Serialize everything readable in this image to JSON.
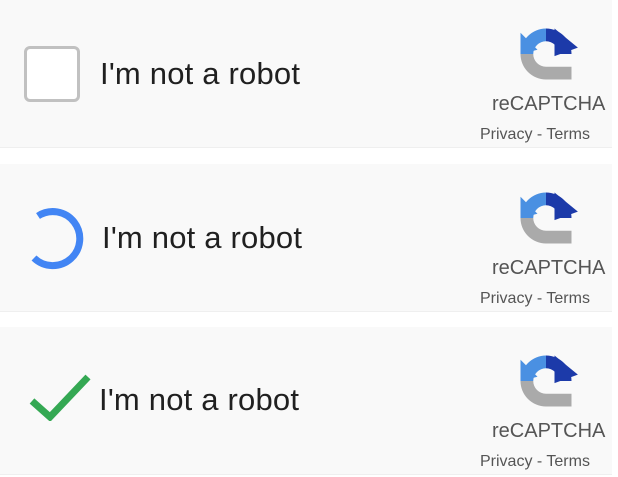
{
  "colors": {
    "spinner": "#4285f4",
    "check": "#34a853",
    "logo_blue_dark": "#1c3aa9",
    "logo_blue": "#4a90e2",
    "logo_gray": "#aaaaaa"
  },
  "widgets": [
    {
      "state": "unchecked",
      "label": "I'm not a robot",
      "brand": "reCAPTCHA",
      "privacy": "Privacy",
      "separator": " - ",
      "terms": "Terms"
    },
    {
      "state": "loading",
      "label": "I'm not a robot",
      "brand": "reCAPTCHA",
      "privacy": "Privacy",
      "separator": " - ",
      "terms": "Terms"
    },
    {
      "state": "checked",
      "label": "I'm not a robot",
      "brand": "reCAPTCHA",
      "privacy": "Privacy",
      "separator": " - ",
      "terms": "Terms"
    }
  ]
}
